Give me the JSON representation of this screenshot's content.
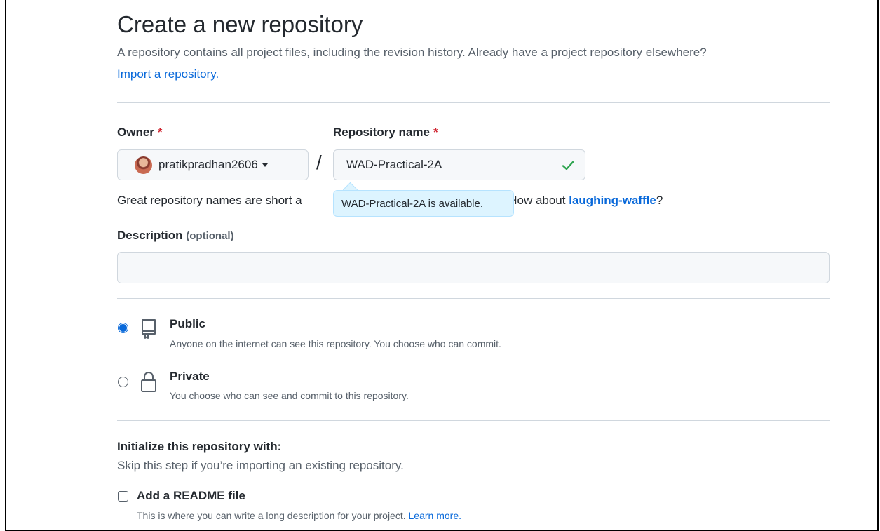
{
  "page": {
    "title": "Create a new repository",
    "subtitle": "A repository contains all project files, including the revision history. Already have a project repository elsewhere?",
    "import_link": "Import a repository."
  },
  "owner": {
    "label": "Owner",
    "required_mark": "*",
    "value": "pratikpradhan2606"
  },
  "repo_name": {
    "label": "Repository name",
    "required_mark": "*",
    "value": "WAD-Practical-2A",
    "separator": "/"
  },
  "name_hint": {
    "text_start": "Great repository names are short a",
    "text_end": "tion? How about ",
    "suggestion": "laughing-waffle",
    "suffix": "?"
  },
  "tooltip": {
    "text": "WAD-Practical-2A is available."
  },
  "description": {
    "label": "Description",
    "optional": "(optional)",
    "value": ""
  },
  "visibility": {
    "public": {
      "title": "Public",
      "desc": "Anyone on the internet can see this repository. You choose who can commit.",
      "selected": true
    },
    "private": {
      "title": "Private",
      "desc": "You choose who can see and commit to this repository.",
      "selected": false
    }
  },
  "initialize": {
    "heading": "Initialize this repository with:",
    "subheading": "Skip this step if you’re importing an existing repository.",
    "readme_label": "Add a README file",
    "readme_desc": "This is where you can write a long description for your project.",
    "learn_more": "Learn more."
  },
  "colors": {
    "accent": "#0969da",
    "success": "#2da44e",
    "danger": "#cf222e",
    "tooltip_bg": "#ddf4ff"
  }
}
